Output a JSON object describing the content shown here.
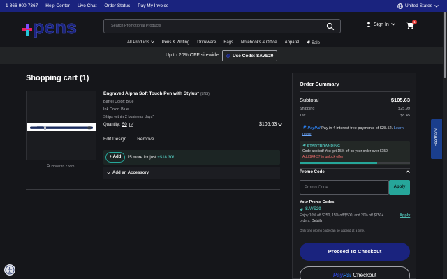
{
  "topbar": {
    "links": [
      "1-866-900-7367",
      "Help Center",
      "Live Chat",
      "Order Status",
      "Pay My Invoice"
    ],
    "country": "United States"
  },
  "header": {
    "logo_text": "pens",
    "search_placeholder": "Search Promotional Products",
    "signin": "Sign In",
    "cart_count": "1"
  },
  "nav": [
    "All Products",
    "Pens & Writing",
    "Drinkware",
    "Bags",
    "Notebooks & Office",
    "Apparel",
    "Sale"
  ],
  "promo_bar": {
    "text": "Up to 20% OFF sitewide",
    "code": "Use Code: SAVE20"
  },
  "cart": {
    "title": "Shopping cart (1)",
    "hover_zoom": "Hover to Zoom",
    "item": {
      "name": "Engraved Alpha Soft Touch Pen with Stylus*",
      "sku": "(LNS)",
      "barrel_color": "Barrel Color: Blue",
      "ink_color": "Ink Color: Blue",
      "ships": "Ships within 2 business days*",
      "quantity_label": "Quantity:",
      "quantity": "50",
      "price": "$105.63",
      "edit": "Edit Design",
      "remove": "Remove"
    },
    "upsell": {
      "add_label": "+ Add",
      "text": "15 more for just",
      "amount": "+$18.30!"
    },
    "accessory": "Add an Accessory"
  },
  "summary": {
    "title": "Order Summary",
    "subtotal_label": "Subtotal",
    "subtotal": "$105.63",
    "shipping_label": "Shipping",
    "shipping": "$25.99",
    "tax_label": "Tax",
    "tax": "$8.45",
    "paypal_brand": "PayPal",
    "paypal_text": "Pay in 4 interest-free payments of $28.52.",
    "learn_more": "Learn more",
    "branding": {
      "title": "STARTBRANDING",
      "applied": "Code applied! You get 15% off on your order over $150",
      "unlock": "Add $44.37 to unlock offer",
      "progress": 0.7
    },
    "promo_code_label": "Promo Code",
    "promo_placeholder": "Promo Code",
    "apply": "Apply",
    "your_codes": "Your Promo Codes",
    "code": {
      "name": "SAVE20",
      "desc": "Enjoy 10% off $250, 15% off $500, and 20% off $750+ orders.",
      "details": "Details",
      "apply": "Apply"
    },
    "one_code_note": "Only one promo code can be applied at a time.",
    "checkout": "Proceed To Checkout",
    "paypal_checkout_1": "Pay",
    "paypal_checkout_2": "Pal",
    "paypal_checkout_3": "Checkout"
  },
  "feedback": "Feedback",
  "colors": {
    "navy": "#1a237e",
    "teal": "#26a69a",
    "bg": "#15161a",
    "paypal_blue": "#2b7de9",
    "warn_red": "#ef6c6c"
  }
}
